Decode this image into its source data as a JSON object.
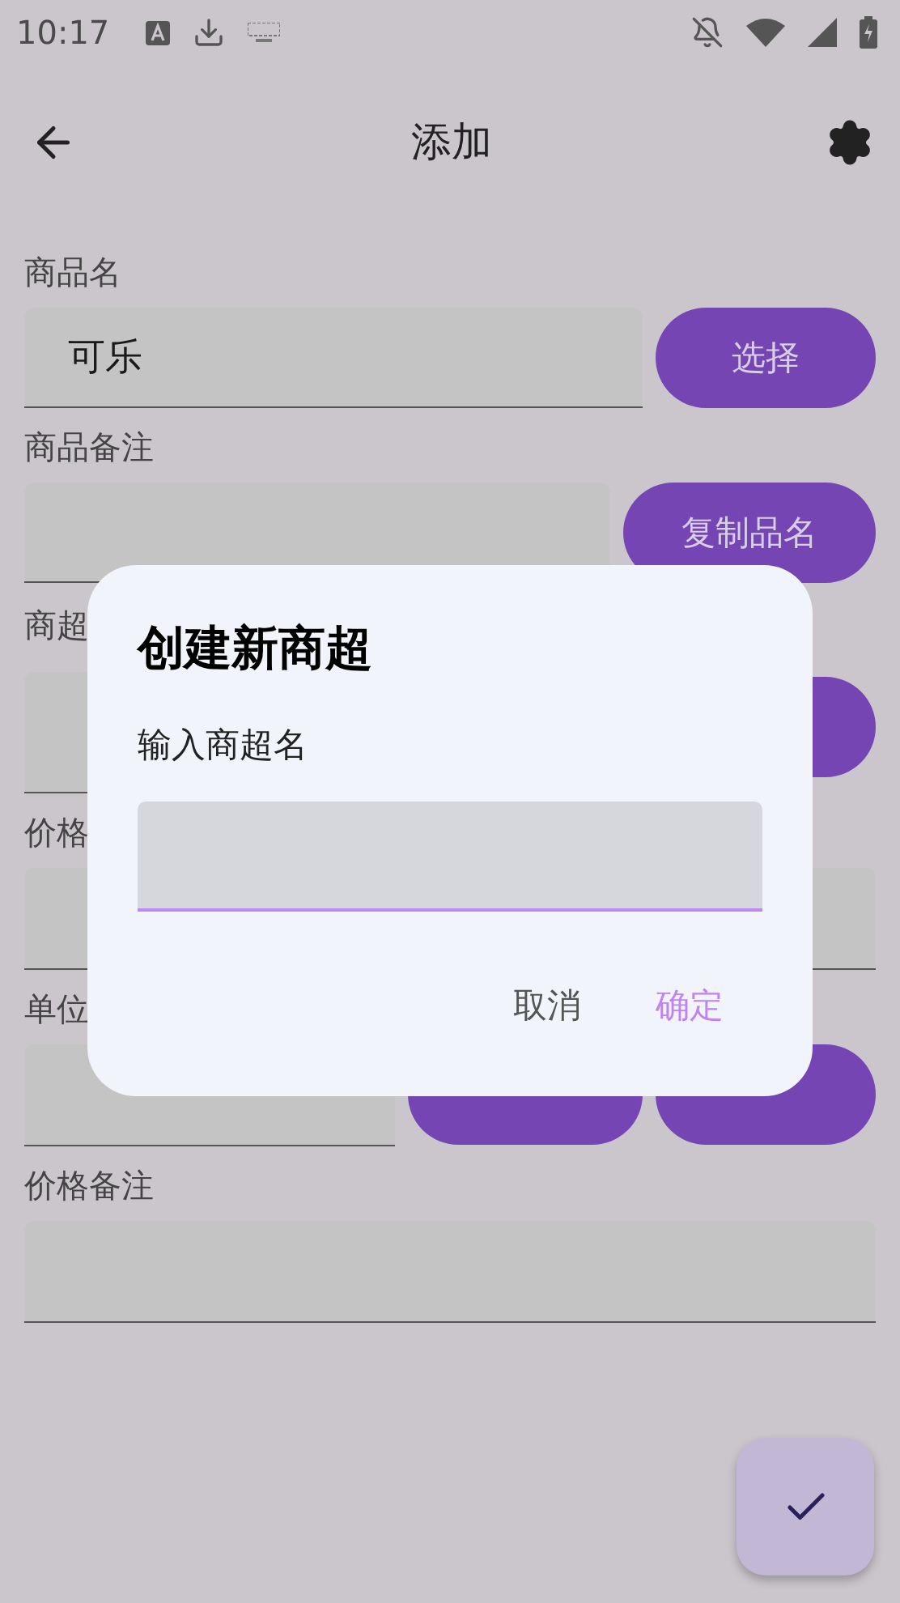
{
  "status_bar": {
    "time": "10:17"
  },
  "app_bar": {
    "title": "添加"
  },
  "form": [
    {
      "kind": "field_button",
      "label": "商品名",
      "value": "可乐",
      "buttons": [
        "选择"
      ]
    },
    {
      "kind": "field_button",
      "label": "商品备注",
      "buttons": [
        "复制品名"
      ]
    },
    {
      "kind": "select_button",
      "label": "商超"
    },
    {
      "kind": "field",
      "label": "价格"
    },
    {
      "kind": "field_two_buttons",
      "label": "单位"
    },
    {
      "kind": "field",
      "label": "价格备注"
    }
  ],
  "dialog": {
    "title": "创建新商超",
    "label": "输入商超名",
    "buttons": [
      {
        "label": "取消",
        "kind": "neutral"
      },
      {
        "label": "确定",
        "kind": "primary"
      }
    ]
  }
}
